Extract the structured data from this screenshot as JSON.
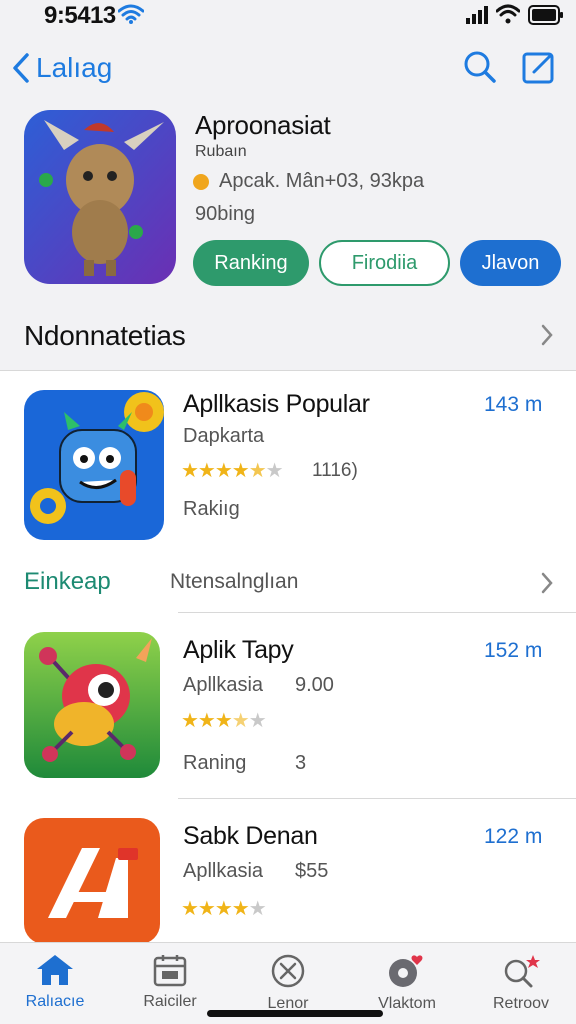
{
  "status": {
    "time": "9:5413"
  },
  "nav": {
    "back_label": "Lalıag"
  },
  "hero": {
    "title": "Aproonasiat",
    "subtitle": "Rubaın",
    "meta": "Apcak. Mân+03, 93kpa",
    "ranking_text": "90bing",
    "buttons": [
      "Ranking",
      "Firodiia",
      "Jlavon"
    ]
  },
  "section": {
    "title": "Ndonnatetias"
  },
  "apps": [
    {
      "title": "Apllkasis Popular",
      "size": "143 m",
      "subtitle": "Dapkarta",
      "rating": 4.5,
      "rating_count": "1116)",
      "note": "Rakiıg"
    },
    {
      "title": "Aplik Tapy",
      "size": "152 m",
      "subtitle": "Apllkasia",
      "subtitle_extra": "9.00",
      "rating": 3.5,
      "note": "Raning",
      "note_extra": "3"
    },
    {
      "title": "Sabk Denan",
      "size": "122 m",
      "subtitle": "Apllkasia",
      "subtitle_extra": "$55",
      "rating": 4
    }
  ],
  "row": {
    "label_green": "Einkeap",
    "label_grey": "Ntensalnglıan"
  },
  "tabs": [
    {
      "label": "Ralıacıe",
      "icon": "home-icon"
    },
    {
      "label": "Raiciler",
      "icon": "calendar-icon"
    },
    {
      "label": "Lenor",
      "icon": "circle-x-icon"
    },
    {
      "label": "Vlaktom",
      "icon": "chat-heart-icon"
    },
    {
      "label": "Retroov",
      "icon": "search-star-icon"
    }
  ],
  "colors": {
    "accent": "#1e6fd0",
    "green": "#2e9a6c",
    "star": "#f0b418"
  }
}
